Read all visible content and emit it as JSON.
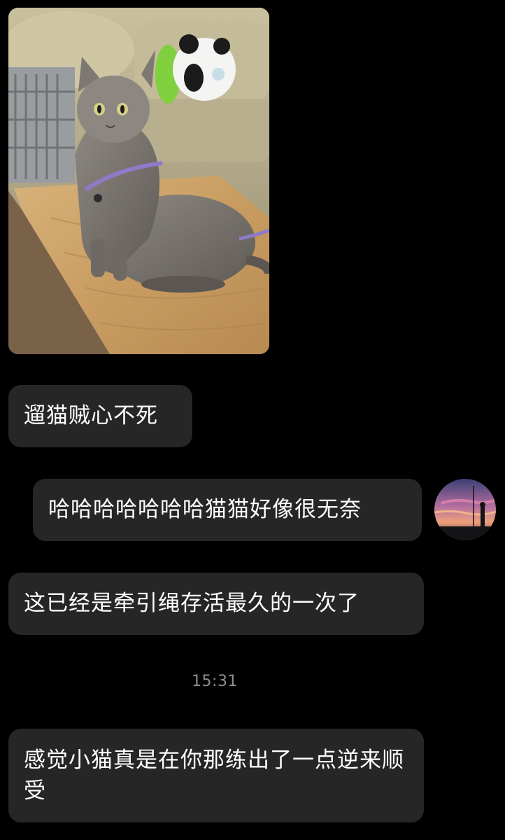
{
  "chat": {
    "photo": {
      "image": "cat-on-table-wearing-harness-photo",
      "description_icon": "cat-photo"
    },
    "messages": [
      {
        "side": "left",
        "text": "遛猫贼心不死"
      },
      {
        "side": "right",
        "text": "哈哈哈哈哈哈哈猫猫好像很无奈"
      },
      {
        "side": "left",
        "text": "这已经是牵引绳存活最久的一次了"
      },
      {
        "side": "left",
        "text": "感觉小猫真是在你那练出了一点逆来顺受"
      }
    ],
    "timestamp": "15:31",
    "avatar": {
      "icon": "sunset-avatar-icon"
    }
  },
  "colors": {
    "background": "#000000",
    "bubble": "#262626",
    "text": "#ffffff",
    "timestamp": "#8e8e8e"
  }
}
